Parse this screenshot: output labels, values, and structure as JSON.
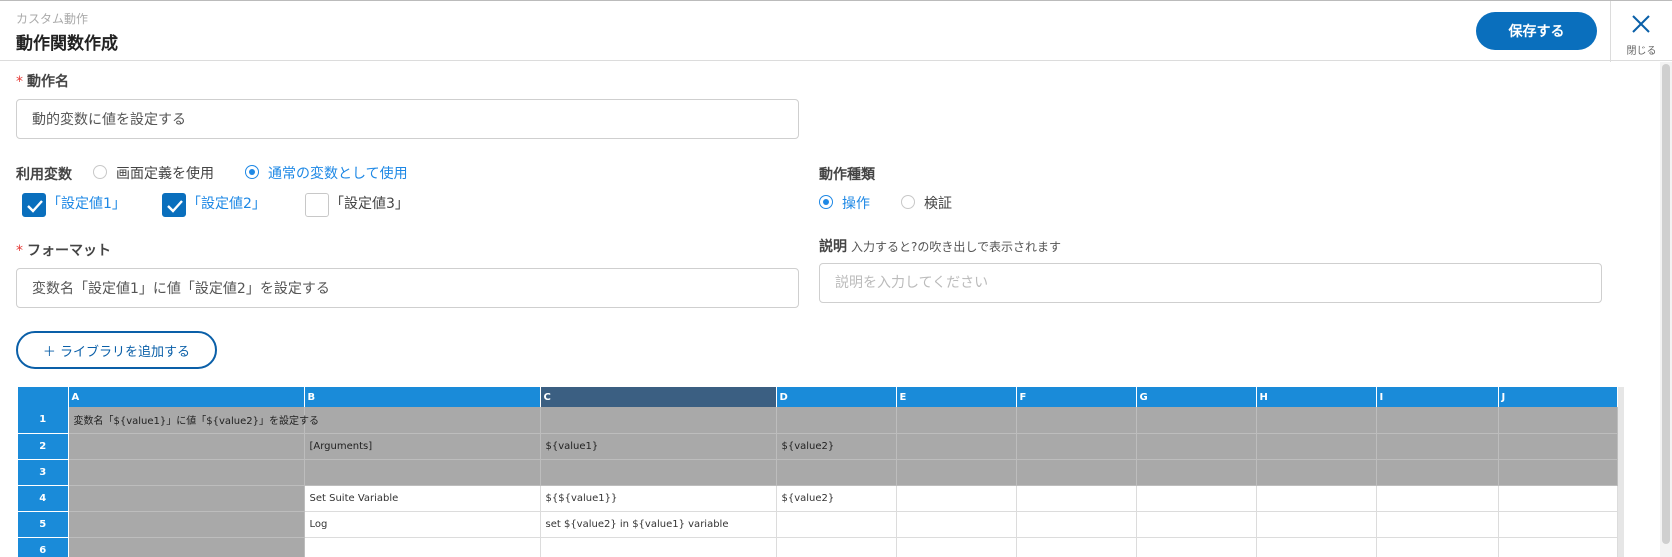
{
  "header": {
    "subtitle": "カスタム動作",
    "title": "動作関数作成",
    "save_label": "保存する",
    "close_label": "閉じる"
  },
  "action_name": {
    "label": "動作名",
    "value": "動的変数に値を設定する"
  },
  "variables": {
    "label": "利用変数",
    "options": [
      {
        "label": "画面定義を使用",
        "selected": false
      },
      {
        "label": "通常の変数として使用",
        "selected": true
      }
    ],
    "checks": [
      {
        "label": "「設定値1」",
        "checked": true
      },
      {
        "label": "「設定値2」",
        "checked": true
      },
      {
        "label": "「設定値3」",
        "checked": false
      }
    ]
  },
  "action_type": {
    "label": "動作種類",
    "options": [
      {
        "label": "操作",
        "selected": true
      },
      {
        "label": "検証",
        "selected": false
      }
    ]
  },
  "format": {
    "label": "フォーマット",
    "value": "変数名「設定値1」に値「設定値2」を設定する"
  },
  "description": {
    "label": "説明",
    "help": "入力すると?の吹き出しで表示されます",
    "placeholder": "説明を入力してください"
  },
  "add_library_label": "＋ ライブラリを追加する",
  "sheet": {
    "columns": [
      "A",
      "B",
      "C",
      "D",
      "E",
      "F",
      "G",
      "H",
      "I",
      "J"
    ],
    "selected_column": "C",
    "rows": [
      {
        "num": "1",
        "cells": [
          "変数名「${value1}」に値「${value2}」を設定する",
          "",
          "",
          "",
          "",
          "",
          "",
          "",
          "",
          ""
        ]
      },
      {
        "num": "2",
        "cells": [
          "",
          "[Arguments]",
          "${value1}",
          "${value2}",
          "",
          "",
          "",
          "",
          "",
          ""
        ]
      },
      {
        "num": "3",
        "cells": [
          "",
          "",
          "",
          "",
          "",
          "",
          "",
          "",
          "",
          ""
        ]
      },
      {
        "num": "4",
        "cells": [
          "",
          "Set Suite Variable",
          "${${value1}}",
          "${value2}",
          "",
          "",
          "",
          "",
          "",
          ""
        ]
      },
      {
        "num": "5",
        "cells": [
          "",
          "Log",
          "set ${value2} in ${value1} variable",
          "",
          "",
          "",
          "",
          "",
          "",
          ""
        ]
      },
      {
        "num": "6",
        "cells": [
          "",
          "",
          "",
          "",
          "",
          "",
          "",
          "",
          "",
          ""
        ]
      }
    ]
  }
}
